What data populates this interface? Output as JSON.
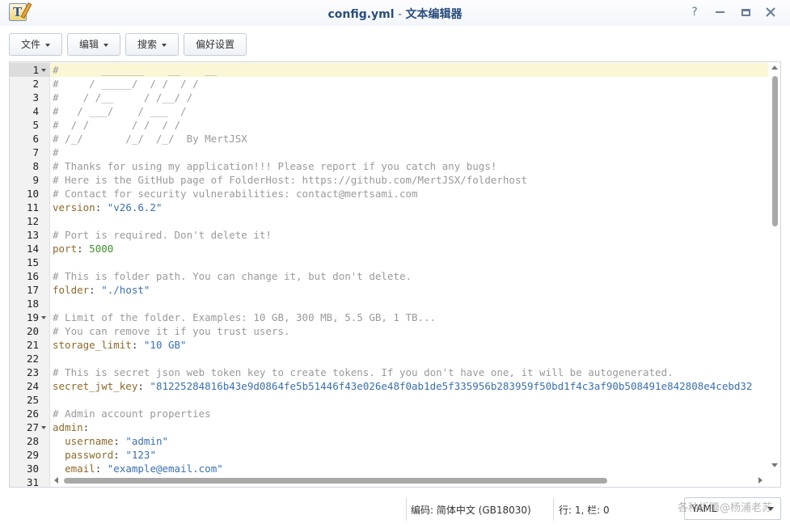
{
  "window": {
    "title_file": "config.yml",
    "title_sep": " - ",
    "title_app": "文本编辑器",
    "help_icon": "?",
    "icons": [
      "app-text-editor-icon",
      "help-icon",
      "minimize-icon",
      "maximize-icon",
      "close-icon"
    ]
  },
  "toolbar": {
    "file": "文件",
    "edit": "编辑",
    "search": "搜索",
    "prefs": "偏好设置"
  },
  "editor": {
    "active_line": 1,
    "fold_lines": [
      1,
      19,
      27
    ],
    "lines": [
      {
        "n": "1",
        "t": [
          [
            "cm",
            "#       _______    __    __"
          ]
        ]
      },
      {
        "n": "2",
        "t": [
          [
            "cm",
            "#     / _____/  / /  / /"
          ]
        ]
      },
      {
        "n": "3",
        "t": [
          [
            "cm",
            "#    / /__     / /__/ /"
          ]
        ]
      },
      {
        "n": "4",
        "t": [
          [
            "cm",
            "#   / ___/    / ___  /"
          ]
        ]
      },
      {
        "n": "5",
        "t": [
          [
            "cm",
            "#  / /       / /  / /"
          ]
        ]
      },
      {
        "n": "6",
        "t": [
          [
            "cm",
            "# /_/       /_/  /_/  By MertJSX"
          ]
        ]
      },
      {
        "n": "7",
        "t": [
          [
            "cm",
            "#"
          ]
        ]
      },
      {
        "n": "8",
        "t": [
          [
            "cm",
            "# Thanks for using my application!!! Please report if you catch any bugs!"
          ]
        ]
      },
      {
        "n": "9",
        "t": [
          [
            "cm",
            "# Here is the GitHub page of FolderHost: https://github.com/MertJSX/folderhost"
          ]
        ]
      },
      {
        "n": "10",
        "t": [
          [
            "cm",
            "# Contact for security vulnerabilities: contact@mertsami.com"
          ]
        ]
      },
      {
        "n": "11",
        "t": [
          [
            "key",
            "version"
          ],
          [
            "plain",
            ": "
          ],
          [
            "str",
            "\"v26.6.2\""
          ]
        ]
      },
      {
        "n": "12",
        "t": []
      },
      {
        "n": "13",
        "t": [
          [
            "cm",
            "# Port is required. Don't delete it!"
          ]
        ]
      },
      {
        "n": "14",
        "t": [
          [
            "key",
            "port"
          ],
          [
            "plain",
            ": "
          ],
          [
            "num",
            "5000"
          ]
        ]
      },
      {
        "n": "15",
        "t": []
      },
      {
        "n": "16",
        "t": [
          [
            "cm",
            "# This is folder path. You can change it, but don't delete."
          ]
        ]
      },
      {
        "n": "17",
        "t": [
          [
            "key",
            "folder"
          ],
          [
            "plain",
            ": "
          ],
          [
            "str",
            "\"./host\""
          ]
        ]
      },
      {
        "n": "18",
        "t": []
      },
      {
        "n": "19",
        "t": [
          [
            "cm",
            "# Limit of the folder. Examples: 10 GB, 300 MB, 5.5 GB, 1 TB..."
          ]
        ]
      },
      {
        "n": "20",
        "t": [
          [
            "cm",
            "# You can remove it if you trust users."
          ]
        ]
      },
      {
        "n": "21",
        "t": [
          [
            "key",
            "storage_limit"
          ],
          [
            "plain",
            ": "
          ],
          [
            "str",
            "\"10 GB\""
          ]
        ]
      },
      {
        "n": "22",
        "t": []
      },
      {
        "n": "23",
        "t": [
          [
            "cm",
            "# This is secret json web token key to create tokens. If you don't have one, it will be autogenerated."
          ]
        ]
      },
      {
        "n": "24",
        "t": [
          [
            "key",
            "secret_jwt_key"
          ],
          [
            "plain",
            ": "
          ],
          [
            "str",
            "\"81225284816b43e9d0864fe5b51446f43e026e48f0ab1de5f335956b283959f50bd1f4c3af90b508491e842808e4cebd32"
          ]
        ]
      },
      {
        "n": "25",
        "t": []
      },
      {
        "n": "26",
        "t": [
          [
            "cm",
            "# Admin account properties"
          ]
        ]
      },
      {
        "n": "27",
        "t": [
          [
            "key",
            "admin"
          ],
          [
            "plain",
            ":"
          ]
        ]
      },
      {
        "n": "28",
        "t": [
          [
            "plain",
            "  "
          ],
          [
            "key",
            "username"
          ],
          [
            "plain",
            ": "
          ],
          [
            "str",
            "\"admin\""
          ]
        ]
      },
      {
        "n": "29",
        "t": [
          [
            "plain",
            "  "
          ],
          [
            "key",
            "password"
          ],
          [
            "plain",
            ": "
          ],
          [
            "str",
            "\"123\""
          ]
        ]
      },
      {
        "n": "30",
        "t": [
          [
            "plain",
            "  "
          ],
          [
            "key",
            "email"
          ],
          [
            "plain",
            ": "
          ],
          [
            "str",
            "\"example@email.com\""
          ]
        ]
      },
      {
        "n": "31",
        "t": []
      }
    ]
  },
  "scroll": {
    "vertical_position": 0.0,
    "horizontal_position": 0.0
  },
  "status": {
    "encoding": "编码: 简体中文 (GB18030)",
    "cursor": "行: 1, 栏: 0",
    "mode": "YAML",
    "watermark": "各种折腾@杨浦老苏"
  }
}
